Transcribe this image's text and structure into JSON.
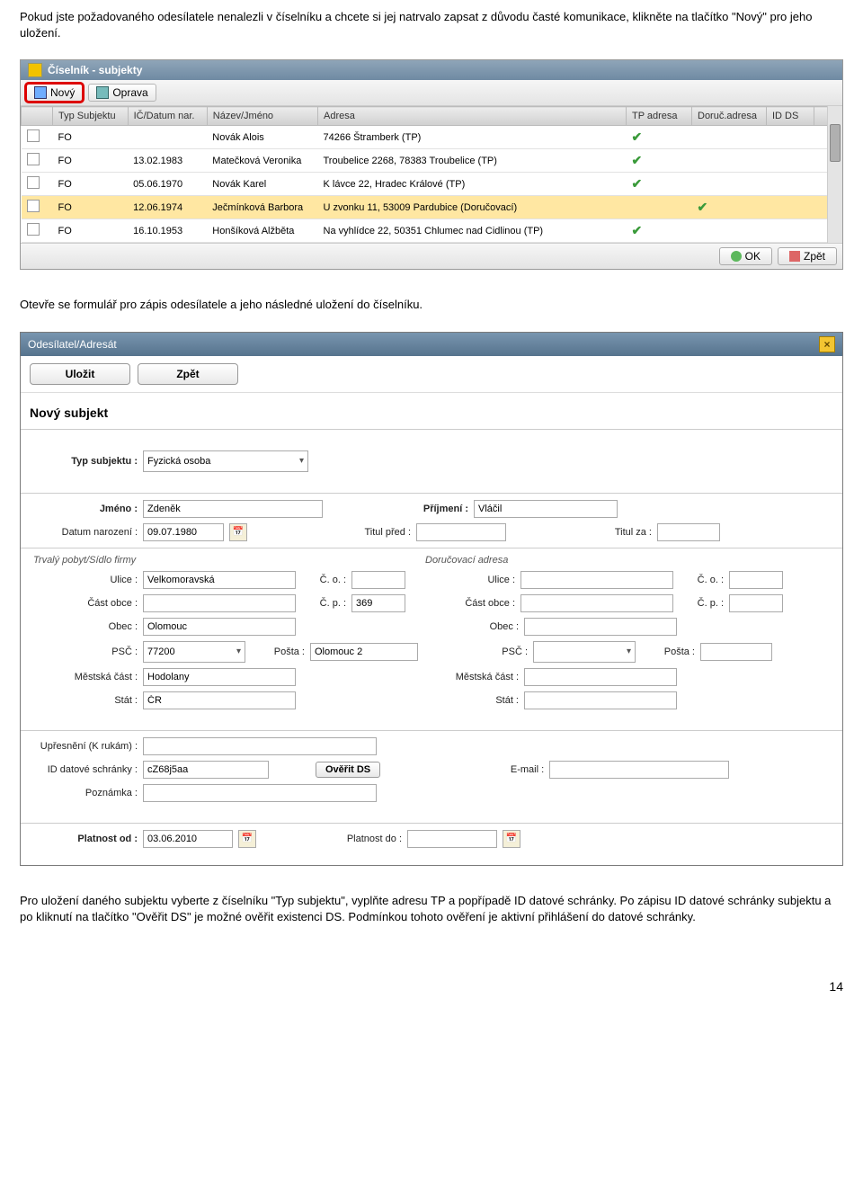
{
  "para1": "Pokud jste požadovaného odesílatele nenalezli v číselníku a chcete si jej natrvalo zapsat z důvodu časté komunikace, klikněte na tlačítko \"Nový\" pro jeho uložení.",
  "shot1": {
    "title": "Číselník - subjekty",
    "toolbar": {
      "novy": "Nový",
      "oprava": "Oprava"
    },
    "cols": {
      "typ": "Typ Subjektu",
      "ic": "IČ/Datum nar.",
      "nazev": "Název/Jméno",
      "adresa": "Adresa",
      "tp": "TP adresa",
      "doruc": "Doruč.adresa",
      "idds": "ID DS"
    },
    "rows": [
      {
        "typ": "FO",
        "ic": "",
        "nazev": "Novák Alois",
        "adresa": "74266 Štramberk (TP)",
        "tp": true
      },
      {
        "typ": "FO",
        "ic": "13.02.1983",
        "nazev": "Matečková Veronika",
        "adresa": "Troubelice 2268, 78383 Troubelice (TP)",
        "tp": true
      },
      {
        "typ": "FO",
        "ic": "05.06.1970",
        "nazev": "Novák Karel",
        "adresa": "K lávce 22, Hradec Králové (TP)",
        "tp": true
      },
      {
        "typ": "FO",
        "ic": "12.06.1974",
        "nazev": "Ječmínková Barbora",
        "adresa": "U zvonku 11, 53009 Pardubice (Doručovací)",
        "doruc": true,
        "hl": true
      },
      {
        "typ": "FO",
        "ic": "16.10.1953",
        "nazev": "Honšíková Alžběta",
        "adresa": "Na vyhlídce 22, 50351 Chlumec nad Cidlinou (TP)",
        "tp": true
      }
    ],
    "ok": "OK",
    "back": "Zpět"
  },
  "para2": "Otevře se formulář pro zápis odesílatele a jeho následné uložení do číselníku.",
  "shot2": {
    "title": "Odesílatel/Adresát",
    "btn": {
      "save": "Uložit",
      "back": "Zpět",
      "verify": "Ověřit DS"
    },
    "header": "Nový subjekt",
    "labels": {
      "typ": "Typ subjektu :",
      "jmeno": "Jméno :",
      "prijmeni": "Příjmení :",
      "datum": "Datum narození :",
      "titul_pred": "Titul před :",
      "titul_za": "Titul za :",
      "tp": "Trvalý pobyt/Sídlo firmy",
      "doruc": "Doručovací adresa",
      "ulice": "Ulice :",
      "co": "Č. o. :",
      "cast": "Část obce :",
      "cp": "Č. p. :",
      "obec": "Obec :",
      "psc": "PSČ :",
      "posta": "Pošta :",
      "mest": "Městská část :",
      "stat": "Stát :",
      "upres": "Upřesnění (K rukám) :",
      "idds": "ID datové schránky :",
      "email": "E-mail :",
      "pozn": "Poznámka :",
      "plat_od": "Platnost od :",
      "plat_do": "Platnost do :"
    },
    "values": {
      "typ": "Fyzická osoba",
      "jmeno": "Zdeněk",
      "prijmeni": "Vláčil",
      "datum": "09.07.1980",
      "ulice": "Velkomoravská",
      "cp": "369",
      "obec": "Olomouc",
      "psc": "77200",
      "posta": "Olomouc 2",
      "mest": "Hodolany",
      "stat": "ČR",
      "idds": "cZ68j5aa",
      "plat_od": "03.06.2010"
    }
  },
  "para3": "Pro uložení daného subjektu vyberte z číselníku \"Typ subjektu\", vyplňte adresu TP a popřípadě ID datové schránky. Po zápisu ID datové schránky subjektu a po kliknutí na tlačítko \"Ověřit DS\" je možné ověřit existenci DS. Podmínkou tohoto ověření je aktivní přihlášení do datové schránky.",
  "page_num": "14"
}
